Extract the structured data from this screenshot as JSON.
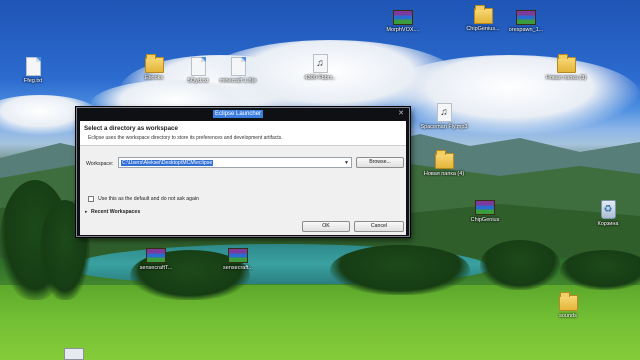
{
  "desktop": {
    "icons": [
      {
        "id": "ffeg",
        "label": "Ffeg.txt",
        "glyph": "text-file-icon"
      },
      {
        "id": "folder-a",
        "label": "Ebooks",
        "glyph": "folder-icon"
      },
      {
        "id": "soyd",
        "label": "5Oyd.txt",
        "glyph": "text-file-icon"
      },
      {
        "id": "misc",
        "label": "minecraft 1.8(e",
        "glyph": "text-file-icon"
      },
      {
        "id": "mp3-top",
        "label": "4300 Fbbrs..",
        "glyph": "mp3-file-icon"
      },
      {
        "id": "morph",
        "label": "MorphVOX....",
        "glyph": "rar-archive-icon"
      },
      {
        "id": "chipgenius-top",
        "label": "ChipGenius...",
        "glyph": "folder-icon"
      },
      {
        "id": "orespawn",
        "label": "orespawn_1...",
        "glyph": "rar-archive-icon"
      },
      {
        "id": "new-folder-1",
        "label": "Новая папка (3)",
        "glyph": "folder-icon"
      },
      {
        "id": "spaceman",
        "label": "Spaceman Fly.mp3",
        "glyph": "mp3-file-icon"
      },
      {
        "id": "new-folder-2",
        "label": "Новая папка (4)",
        "glyph": "folder-icon"
      },
      {
        "id": "chipgenius",
        "label": "ChipGenius",
        "glyph": "rar-archive-icon"
      },
      {
        "id": "recycle",
        "label": "Корзина",
        "glyph": "recycle-bin-icon"
      },
      {
        "id": "sensecraft-1",
        "label": "sensecraftT...",
        "glyph": "rar-archive-icon"
      },
      {
        "id": "sensecraft-2",
        "label": "sensecraft...",
        "glyph": "rar-archive-icon"
      },
      {
        "id": "sounds",
        "label": "sounds",
        "glyph": "folder-icon"
      }
    ]
  },
  "dialog": {
    "title": "Eclipse Launcher",
    "close_glyph": "✕",
    "header_title": "Select a directory as workspace",
    "header_subtitle": "Eclipse uses the workspace directory to store its preferences and development artifacts.",
    "workspace_label": "Workspace:",
    "workspace_value": "C:\\Users\\Aleksei\\Desktop\\MCM\\eclipse",
    "dropdown_glyph": "▼",
    "browse_label": "Browse...",
    "default_checkbox_label": "Use this as the default and do not ask again",
    "default_checked": false,
    "recent_arrow": "▸",
    "recent_label": "Recent Workspaces",
    "ok_label": "OK",
    "cancel_label": "Cancel"
  },
  "colors": {
    "selection": "#2f6fd6",
    "title_highlight": "#3d7fe0",
    "dialog_frame": "#0f1014"
  }
}
